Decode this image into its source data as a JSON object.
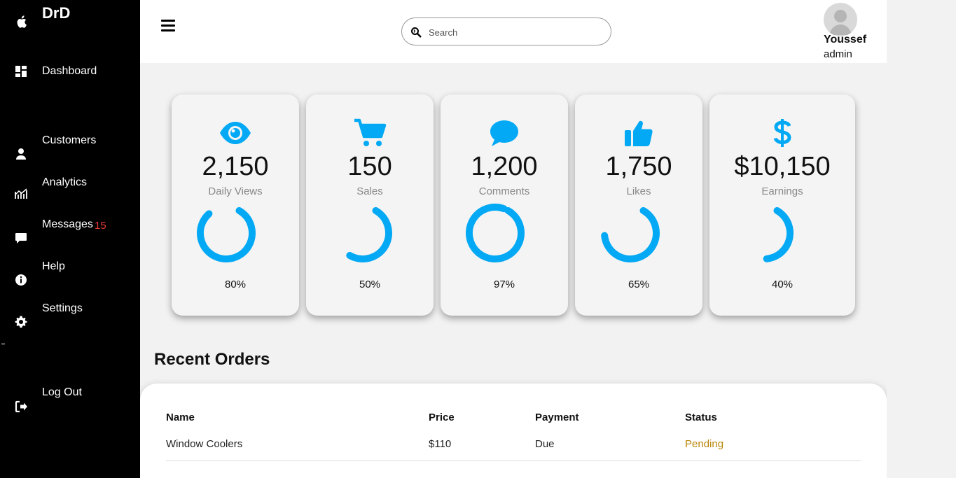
{
  "brand": {
    "name": "DrD"
  },
  "sidebar": {
    "items": [
      {
        "label": "Dashboard",
        "icon": "dashboard-icon"
      },
      {
        "label": "Customers",
        "icon": "user-icon"
      },
      {
        "label": "Analytics",
        "icon": "chart-icon"
      },
      {
        "label": "Messages",
        "icon": "message-icon",
        "badge": "15"
      },
      {
        "label": "Help",
        "icon": "info-icon"
      },
      {
        "label": "Settings",
        "icon": "gear-icon"
      },
      {
        "label": "Log Out",
        "icon": "logout-icon"
      }
    ]
  },
  "search": {
    "placeholder": "Search"
  },
  "user": {
    "name": "Youssef",
    "role": "admin"
  },
  "accent_color": "#03a9f4",
  "cards": [
    {
      "icon": "eye-icon",
      "value": "2,150",
      "label": "Daily Views",
      "percent_text": "80%",
      "percent": 80
    },
    {
      "icon": "cart-icon",
      "value": "150",
      "label": "Sales",
      "percent_text": "50%",
      "percent": 50
    },
    {
      "icon": "comment-icon",
      "value": "1,200",
      "label": "Comments",
      "percent_text": "97%",
      "percent": 97
    },
    {
      "icon": "thumbs-up-icon",
      "value": "1,750",
      "label": "Likes",
      "percent_text": "65%",
      "percent": 65
    },
    {
      "icon": "dollar-icon",
      "value": "$10,150",
      "label": "Earnings",
      "percent_text": "40%",
      "percent": 40
    }
  ],
  "orders": {
    "title": "Recent Orders",
    "columns": [
      "Name",
      "Price",
      "Payment",
      "Status"
    ],
    "rows": [
      {
        "name": "Window Coolers",
        "price": "$110",
        "payment": "Due",
        "status": "Pending",
        "status_color": "#b8860b"
      }
    ]
  }
}
